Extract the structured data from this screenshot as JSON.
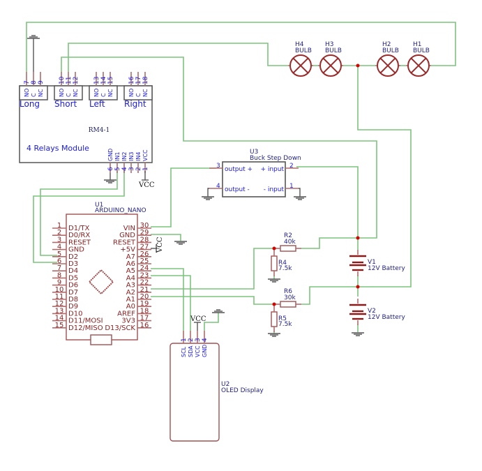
{
  "relay_module": {
    "ref": "RM4-1",
    "name": "4 Relays Module",
    "channels": [
      {
        "label": "Long",
        "pins": [
          {
            "num": "7",
            "name": "NO"
          },
          {
            "num": "8",
            "name": "C"
          },
          {
            "num": "9",
            "name": "NC"
          }
        ]
      },
      {
        "label": "Short",
        "pins": [
          {
            "num": "10",
            "name": "NO"
          },
          {
            "num": "11",
            "name": "C"
          },
          {
            "num": "12",
            "name": "NC"
          }
        ]
      },
      {
        "label": "Left",
        "pins": [
          {
            "num": "13",
            "name": "NO"
          },
          {
            "num": "14",
            "name": "C"
          },
          {
            "num": "15",
            "name": "NC"
          }
        ]
      },
      {
        "label": "Right",
        "pins": [
          {
            "num": "16",
            "name": "NO"
          },
          {
            "num": "17",
            "name": "C"
          },
          {
            "num": "18",
            "name": "NC"
          }
        ]
      }
    ],
    "bottom_pins": [
      {
        "num": "6",
        "name": "GND"
      },
      {
        "num": "5",
        "name": "IN1"
      },
      {
        "num": "4",
        "name": "IN2"
      },
      {
        "num": "3",
        "name": "IN3"
      },
      {
        "num": "2",
        "name": "IN4"
      },
      {
        "num": "1",
        "name": "VCC"
      }
    ]
  },
  "buck": {
    "ref": "U3",
    "name": "Buck Step Down",
    "pins": [
      {
        "num": "3",
        "name": "output +"
      },
      {
        "num": "4",
        "name": "output -"
      },
      {
        "num": "2",
        "name": "+ input"
      },
      {
        "num": "1",
        "name": "- input"
      }
    ]
  },
  "bulbs": [
    {
      "ref": "H4",
      "name": "BULB"
    },
    {
      "ref": "H3",
      "name": "BULB"
    },
    {
      "ref": "H2",
      "name": "BULB"
    },
    {
      "ref": "H1",
      "name": "BULB"
    }
  ],
  "arduino": {
    "ref": "U1",
    "name": "ARDUINO_NANO",
    "left_pins": [
      {
        "num": "1",
        "name": "D1/TX"
      },
      {
        "num": "2",
        "name": "D0/RX"
      },
      {
        "num": "3",
        "name": "RESET"
      },
      {
        "num": "4",
        "name": "GND"
      },
      {
        "num": "5",
        "name": "D2"
      },
      {
        "num": "6",
        "name": "D3"
      },
      {
        "num": "7",
        "name": "D4"
      },
      {
        "num": "8",
        "name": "D5"
      },
      {
        "num": "9",
        "name": "D6"
      },
      {
        "num": "10",
        "name": "D7"
      },
      {
        "num": "11",
        "name": "D8"
      },
      {
        "num": "12",
        "name": "D9"
      },
      {
        "num": "13",
        "name": "D10"
      },
      {
        "num": "14",
        "name": "D11/MOSI"
      },
      {
        "num": "15",
        "name": "D12/MISO"
      }
    ],
    "right_pins": [
      {
        "num": "30",
        "name": "VIN"
      },
      {
        "num": "29",
        "name": "GND"
      },
      {
        "num": "28",
        "name": "RESET"
      },
      {
        "num": "27",
        "name": "+5V"
      },
      {
        "num": "26",
        "name": "A7"
      },
      {
        "num": "25",
        "name": "A6"
      },
      {
        "num": "24",
        "name": "A5"
      },
      {
        "num": "23",
        "name": "A4"
      },
      {
        "num": "22",
        "name": "A3"
      },
      {
        "num": "21",
        "name": "A2"
      },
      {
        "num": "20",
        "name": "A1"
      },
      {
        "num": "19",
        "name": "A0"
      },
      {
        "num": "18",
        "name": "AREF"
      },
      {
        "num": "17",
        "name": "3V3"
      },
      {
        "num": "16",
        "name": "D13/SCK"
      }
    ]
  },
  "resistors": [
    {
      "ref": "R2",
      "value": "40k"
    },
    {
      "ref": "R4",
      "value": "7.5k"
    },
    {
      "ref": "R6",
      "value": "30k"
    },
    {
      "ref": "R5",
      "value": "7.5k"
    }
  ],
  "batteries": [
    {
      "ref": "V1",
      "value": "12V Battery"
    },
    {
      "ref": "V2",
      "value": "12V Battery"
    }
  ],
  "oled": {
    "ref": "U2",
    "name": "OLED Display",
    "pins": [
      {
        "num": "1",
        "name": "SCL"
      },
      {
        "num": "2",
        "name": "SDA"
      },
      {
        "num": "3",
        "name": "VCC"
      },
      {
        "num": "4",
        "name": "GND"
      }
    ]
  },
  "power_labels": {
    "vcc": "VCC"
  }
}
